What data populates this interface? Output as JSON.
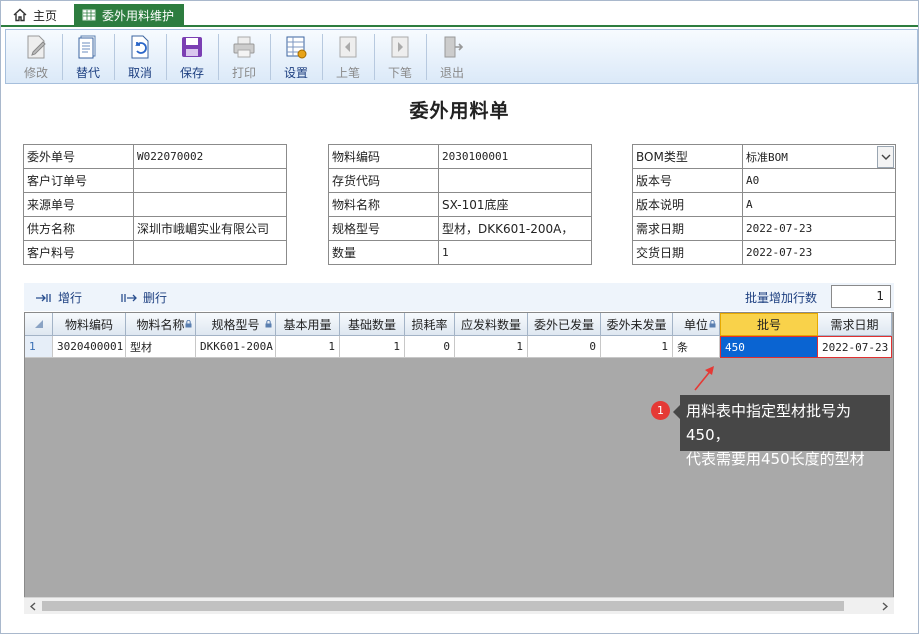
{
  "tabs": {
    "home_label": "主页",
    "active_label": "委外用料维护"
  },
  "toolbar": {
    "buttons": [
      {
        "label": "修改",
        "icon": "edit-doc-icon",
        "enabled": false
      },
      {
        "label": "替代",
        "icon": "document-icon",
        "enabled": true
      },
      {
        "label": "取消",
        "icon": "undo-doc-icon",
        "enabled": true
      },
      {
        "label": "保存",
        "icon": "save-icon",
        "enabled": true
      },
      {
        "label": "打印",
        "icon": "printer-icon",
        "enabled": false
      },
      {
        "label": "设置",
        "icon": "settings-table-icon",
        "enabled": true
      },
      {
        "label": "上笔",
        "icon": "prev-record-icon",
        "enabled": false
      },
      {
        "label": "下笔",
        "icon": "next-record-icon",
        "enabled": false
      },
      {
        "label": "退出",
        "icon": "exit-door-icon",
        "enabled": false
      }
    ]
  },
  "page_title": "委外用料单",
  "form_left": [
    {
      "label": "委外单号",
      "value": "W022070002"
    },
    {
      "label": "客户订单号",
      "value": ""
    },
    {
      "label": "来源单号",
      "value": ""
    },
    {
      "label": "供方名称",
      "value": "深圳市峨嵋实业有限公司"
    },
    {
      "label": "客户料号",
      "value": ""
    }
  ],
  "form_mid": [
    {
      "label": "物料编码",
      "value": "2030100001"
    },
    {
      "label": "存货代码",
      "value": ""
    },
    {
      "label": "物料名称",
      "value": "SX-101底座"
    },
    {
      "label": "规格型号",
      "value": "型材，DKK601-200A，"
    },
    {
      "label": "数量",
      "value": "1"
    }
  ],
  "form_right": [
    {
      "label": "BOM类型",
      "value": "标准BOM"
    },
    {
      "label": "版本号",
      "value": "A0"
    },
    {
      "label": "版本说明",
      "value": "A"
    },
    {
      "label": "需求日期",
      "value": "2022-07-23"
    },
    {
      "label": "交货日期",
      "value": "2022-07-23"
    }
  ],
  "grid_toolbar": {
    "add_row": "增行",
    "delete_row": "删行",
    "batch_label": "批量增加行数",
    "batch_value": "1"
  },
  "grid": {
    "columns": [
      "物料编码",
      "物料名称",
      "规格型号",
      "基本用量",
      "基础数量",
      "损耗率",
      "应发料数量",
      "委外已发量",
      "委外未发量",
      "单位",
      "批号",
      "需求日期"
    ],
    "rows": [
      {
        "row_no": "1",
        "cells": [
          "3020400001",
          "型材",
          "DKK601-200A",
          "1",
          "1",
          "0",
          "1",
          "0",
          "1",
          "条",
          "450",
          "2022-07-23"
        ]
      }
    ]
  },
  "annotation": {
    "badge": "1",
    "text_line1": "用料表中指定型材批号为450，",
    "text_line2": "代表需要用450长度的型材"
  }
}
